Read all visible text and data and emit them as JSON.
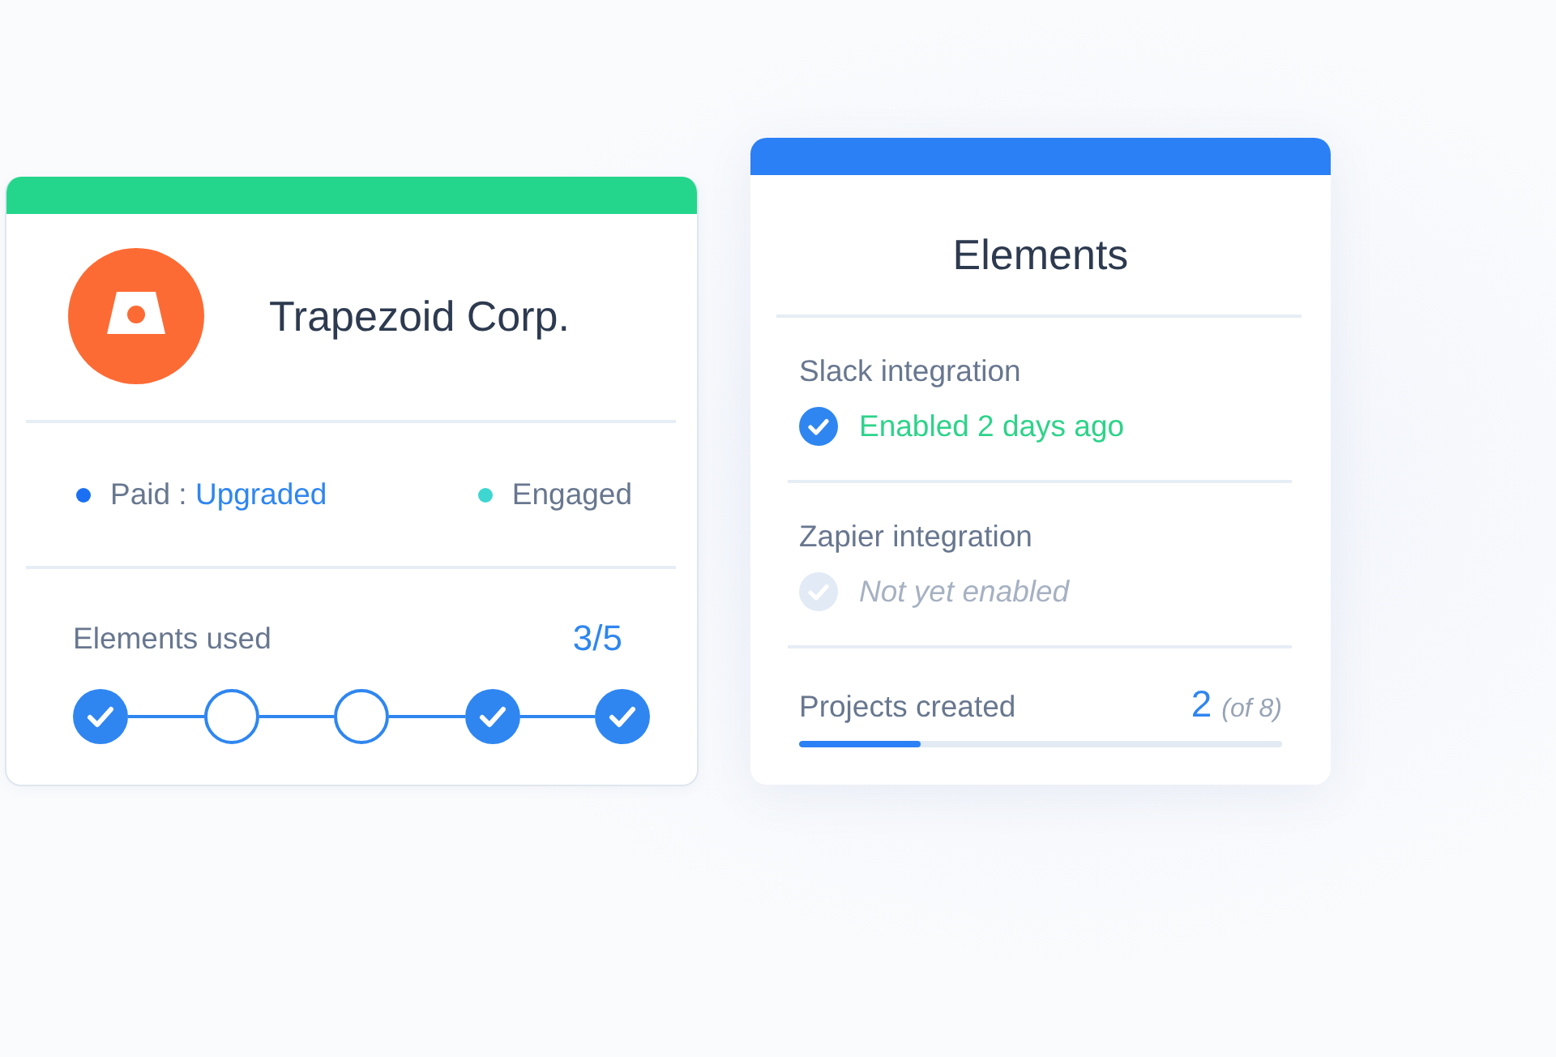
{
  "company_card": {
    "name": "Trapezoid Corp.",
    "tags": [
      {
        "label": "Paid :",
        "value": "Upgraded",
        "color": "#1a6ff2"
      },
      {
        "label": "Engaged",
        "color": "#3dd6d0"
      }
    ],
    "progress": {
      "label": "Elements used",
      "count": "3/5",
      "steps": [
        {
          "checked": true
        },
        {
          "checked": false
        },
        {
          "checked": false
        },
        {
          "checked": true
        },
        {
          "checked": true
        }
      ]
    }
  },
  "elements_card": {
    "title": "Elements",
    "integrations": [
      {
        "name": "Slack integration",
        "enabled": true,
        "status": "Enabled 2 days ago"
      },
      {
        "name": "Zapier integration",
        "enabled": false,
        "status": "Not yet enabled"
      }
    ],
    "projects": {
      "label": "Projects created",
      "count": "2",
      "total": "(of 8)",
      "level": 0.25
    }
  }
}
